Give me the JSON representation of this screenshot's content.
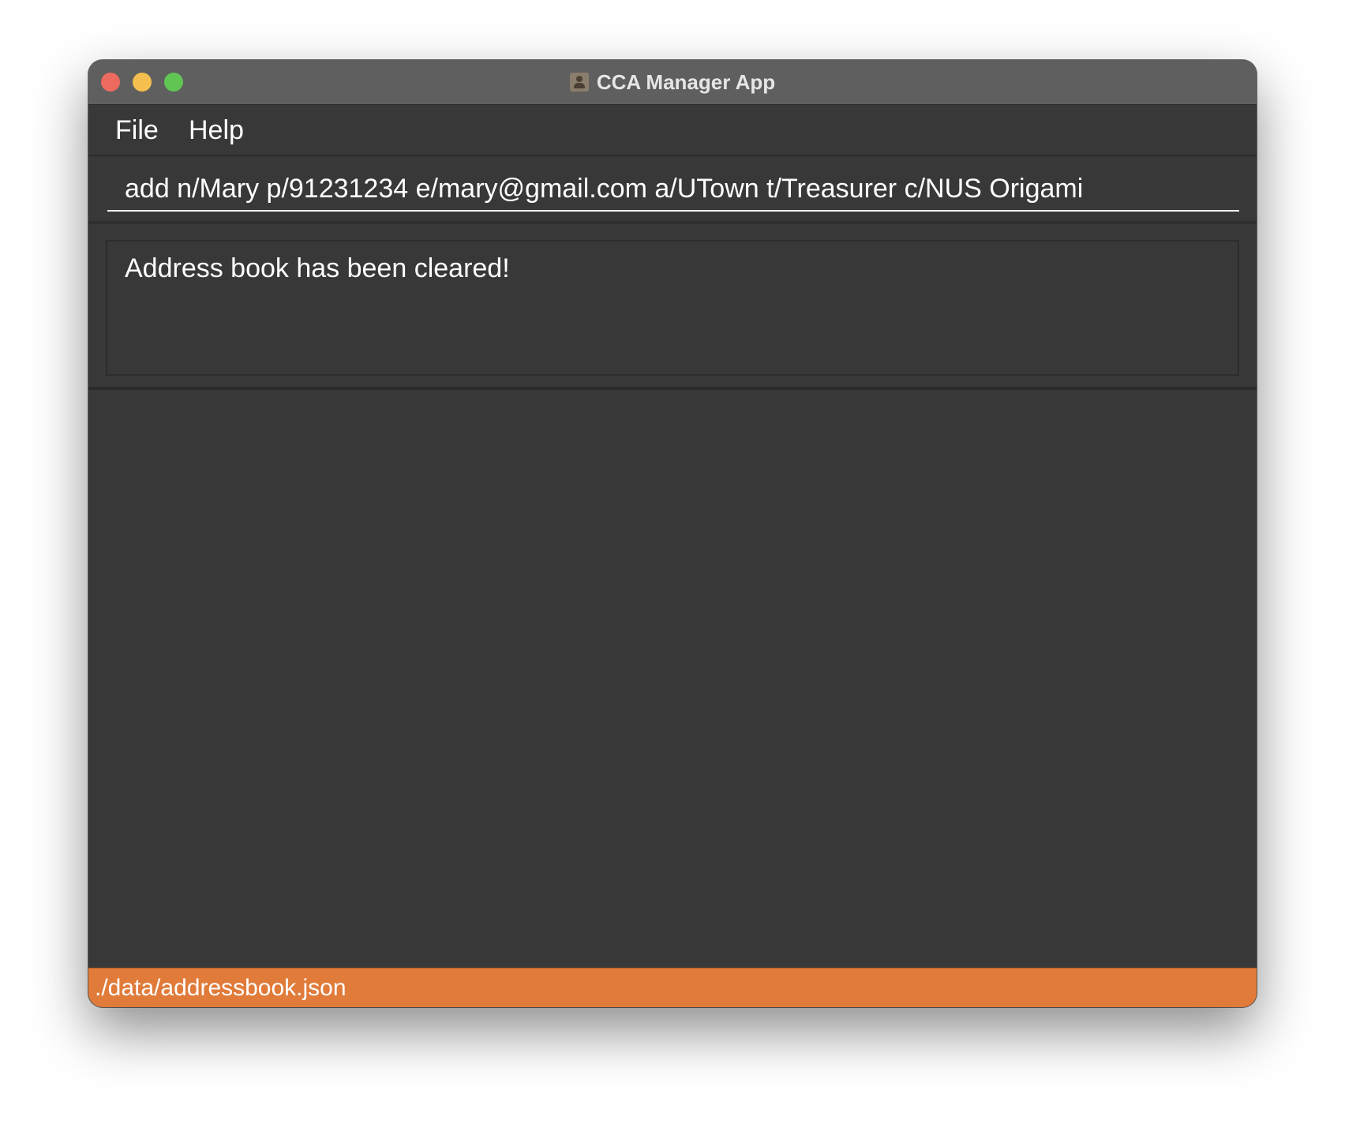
{
  "window": {
    "title": "CCA Manager App",
    "app_icon": "contacts-book-icon"
  },
  "traffic_lights": {
    "close_color": "#ed6a5e",
    "minimize_color": "#f5bf4f",
    "maximize_color": "#61c554"
  },
  "menu": {
    "items": [
      {
        "label": "File"
      },
      {
        "label": "Help"
      }
    ]
  },
  "command_box": {
    "value": "add n/Mary p/91231234 e/mary@gmail.com a/UTown t/Treasurer c/NUS Origami"
  },
  "result_display": {
    "text": "Address book has been cleared!"
  },
  "status_bar": {
    "path": "./data/addressbook.json",
    "color": "#e07b39"
  }
}
